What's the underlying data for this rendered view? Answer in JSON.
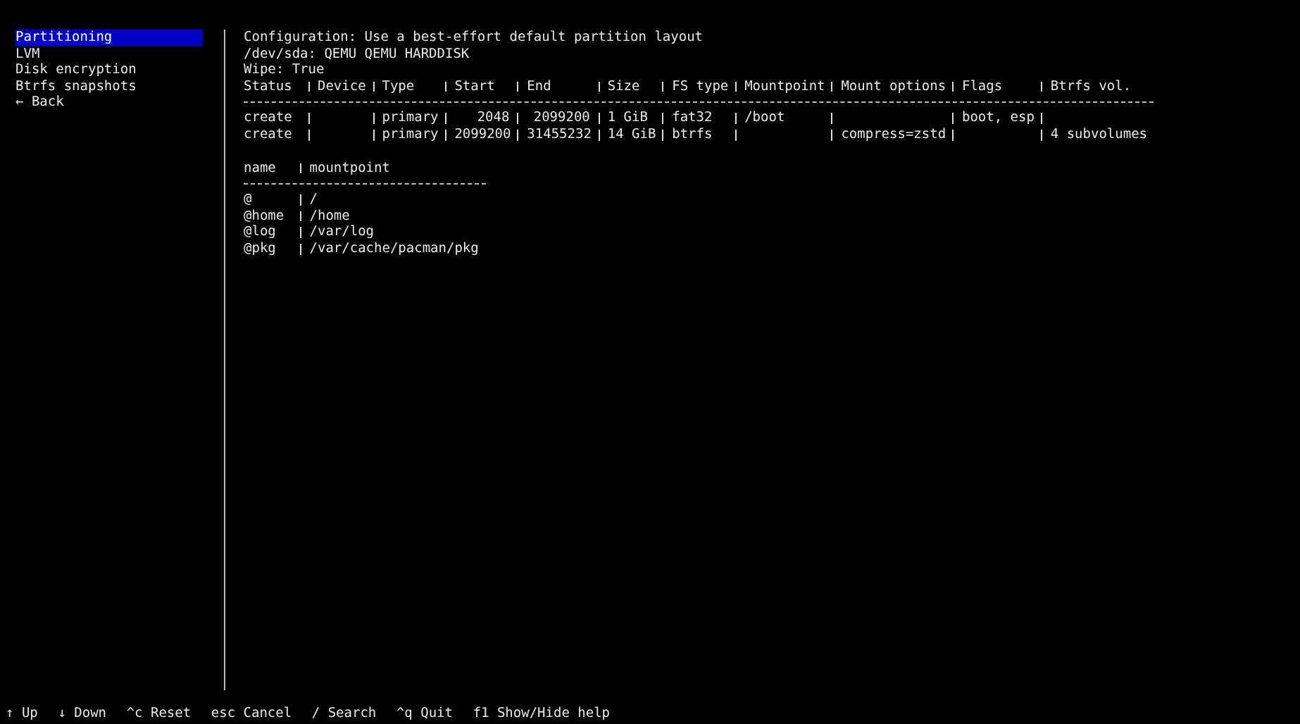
{
  "sidebar": {
    "items": [
      {
        "label": "Partitioning",
        "selected": true
      },
      {
        "label": "LVM",
        "selected": false
      },
      {
        "label": "Disk encryption",
        "selected": false
      },
      {
        "label": "Btrfs snapshots",
        "selected": false
      },
      {
        "label": "← Back",
        "selected": false
      }
    ]
  },
  "info": [
    "Configuration: Use a best-effort default partition layout",
    "/dev/sda: QEMU QEMU HARDDISK",
    "Wipe: True"
  ],
  "partitions": {
    "columns": [
      "Status",
      "Device",
      "Type",
      "Start",
      "End",
      "Size",
      "FS type",
      "Mountpoint",
      "Mount options",
      "Flags",
      "Btrfs vol."
    ],
    "rows": [
      [
        "create",
        "",
        "primary",
        "2048",
        "2099200",
        "1 GiB",
        "fat32",
        "/boot",
        "",
        "boot, esp",
        ""
      ],
      [
        "create",
        "",
        "primary",
        "2099200",
        "31455232",
        "14 GiB",
        "btrfs",
        "",
        "compress=zstd",
        "",
        "4 subvolumes"
      ]
    ]
  },
  "subvolumes": {
    "columns": [
      "name",
      "mountpoint"
    ],
    "rows": [
      [
        "@",
        "/"
      ],
      [
        "@home",
        "/home"
      ],
      [
        "@log",
        "/var/log"
      ],
      [
        "@pkg",
        "/var/cache/pacman/pkg"
      ]
    ]
  },
  "footer": [
    "↑ Up",
    "↓ Down",
    "^c Reset",
    "esc Cancel",
    "/ Search",
    "^q Quit",
    "f1 Show/Hide help"
  ]
}
